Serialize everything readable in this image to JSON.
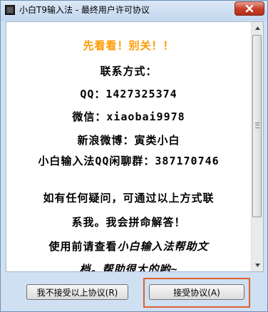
{
  "window": {
    "title": "小白T9输入法 - 最终用户许可协议"
  },
  "license": {
    "lines": [
      "先看看！别关！！",
      "联系方式：",
      "QQ：1427325374",
      "微信：xiaobai9978",
      "新浪微博：寅类小白",
      "小白输入法QQ闲聊群：387170746",
      "",
      "如有任何疑问，可通过以上方式联",
      "系我。我会拼命解答！",
      "使用前请查看",
      "小白输入法帮助文",
      "档。帮助很大的哟~"
    ],
    "highlight_color": "#ff9a00"
  },
  "buttons": {
    "decline": "我不接受以上协议(R)",
    "accept": "接受协议(A)"
  }
}
